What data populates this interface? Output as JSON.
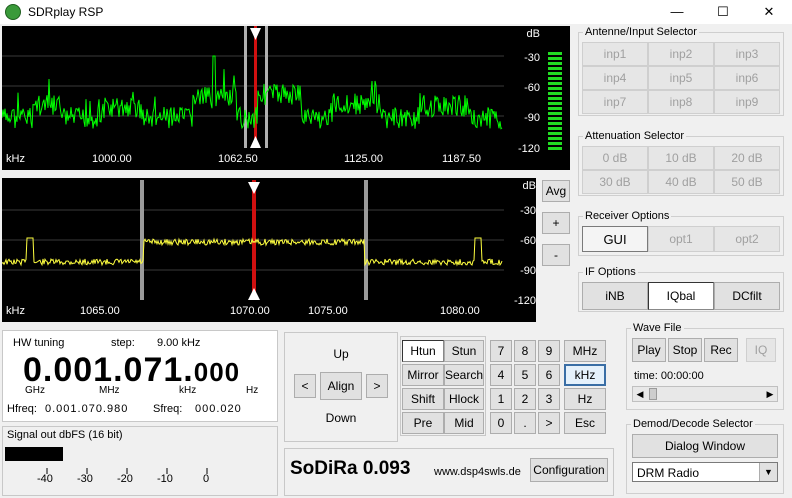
{
  "window": {
    "title": "SDRplay RSP",
    "minimize": "—",
    "maximize": "☐",
    "close": "✕"
  },
  "spectrum_top": {
    "db_labels": [
      "dB",
      "-30",
      "-60",
      "-90",
      "-120"
    ],
    "unit": "kHz",
    "freq_labels": [
      "1000.00",
      "1062.50",
      "1125.00",
      "1187.50"
    ],
    "trace_color": "#00ff00"
  },
  "spectrum_bottom": {
    "db_labels": [
      "dB",
      "-30",
      "-60",
      "-90",
      "-120"
    ],
    "unit": "kHz",
    "freq_labels": [
      "1065.00",
      "1070.00",
      "1075.00",
      "1080.00"
    ],
    "trace_color": "#ffff40"
  },
  "side_buttons": {
    "avg": "Avg",
    "plus": "+",
    "minus": "-"
  },
  "antenna": {
    "title": "Antenne/Input Selector",
    "buttons": [
      "inp1",
      "inp2",
      "inp3",
      "inp4",
      "inp5",
      "inp6",
      "inp7",
      "inp8",
      "inp9"
    ]
  },
  "attenuation": {
    "title": "Attenuation Selector",
    "buttons": [
      "0 dB",
      "10 dB",
      "20 dB",
      "30 dB",
      "40 dB",
      "50 dB"
    ]
  },
  "receiver": {
    "title": "Receiver Options",
    "buttons": [
      "GUI",
      "opt1",
      "opt2"
    ]
  },
  "if_options": {
    "title": "IF Options",
    "buttons": [
      "iNB",
      "IQbal",
      "DCfilt"
    ]
  },
  "wave_file": {
    "title": "Wave File",
    "play": "Play",
    "stop": "Stop",
    "rec": "Rec",
    "iq": "IQ",
    "time_label": "time: 00:00:00"
  },
  "demod": {
    "title": "Demod/Decode Selector",
    "dialog": "Dialog Window",
    "select_value": "DRM Radio"
  },
  "tuning": {
    "hw_tuning": "HW tuning",
    "step_label": "step:",
    "step_value": "9.00 kHz",
    "big_ghz": "0.",
    "big_mhz": "001.",
    "big_khz": "071.",
    "big_hz": "000",
    "unit_ghz": "GHz",
    "unit_mhz": "MHz",
    "unit_khz": "kHz",
    "unit_hz": "Hz",
    "hfreq_label": "Hfreq:",
    "hfreq_value": "0.001.070.980",
    "sfreq_label": "Sfreq:",
    "sfreq_value": "000.020"
  },
  "signal": {
    "title": "Signal out dbFS (16 bit)",
    "ticks": [
      "-40",
      "-30",
      "-20",
      "-10",
      "0"
    ]
  },
  "nav": {
    "up": "Up",
    "down": "Down",
    "left": "<",
    "right": ">",
    "align": "Align"
  },
  "modes": [
    "Htun",
    "Stun",
    "Mirror",
    "Search",
    "Shift",
    "Hlock",
    "Pre",
    "Mid"
  ],
  "keypad": [
    "7",
    "8",
    "9",
    "MHz",
    "4",
    "5",
    "6",
    "kHz",
    "1",
    "2",
    "3",
    "Hz",
    "0",
    ".",
    ">",
    "Esc"
  ],
  "footer": {
    "version": "SoDiRa 0.093",
    "url": "www.dsp4swls.de",
    "config": "Configuration"
  }
}
